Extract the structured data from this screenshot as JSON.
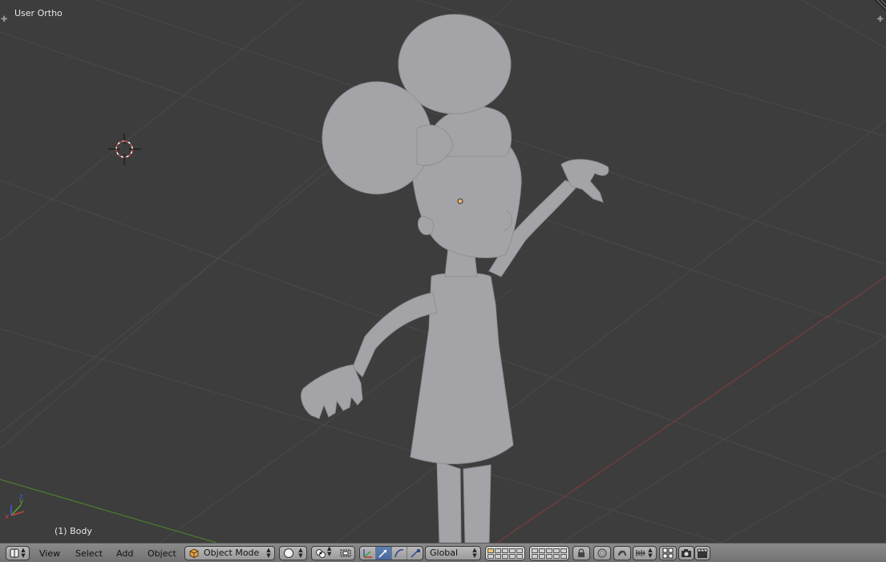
{
  "viewport": {
    "view_name": "User Ortho",
    "active_object": "(1) Body",
    "background_color": "#3d3d3d",
    "grid_color": "#4a4a4a",
    "x_axis_color": "#8a3a3a",
    "y_axis_color": "#4f8a2a",
    "model_color": "#a4a4a8"
  },
  "header": {
    "editor_type_icon": "3d-view-icon",
    "menu": {
      "view": "View",
      "select": "Select",
      "add": "Add",
      "object": "Object"
    },
    "mode": {
      "label": "Object Mode",
      "icon": "cube-icon"
    },
    "shading_icon": "sphere-icon",
    "pivot_icon": "pivot-icon",
    "manipulator_icon": "manipulator-icon",
    "transform_orientation": "Global",
    "accent_color": "#5680c2"
  }
}
